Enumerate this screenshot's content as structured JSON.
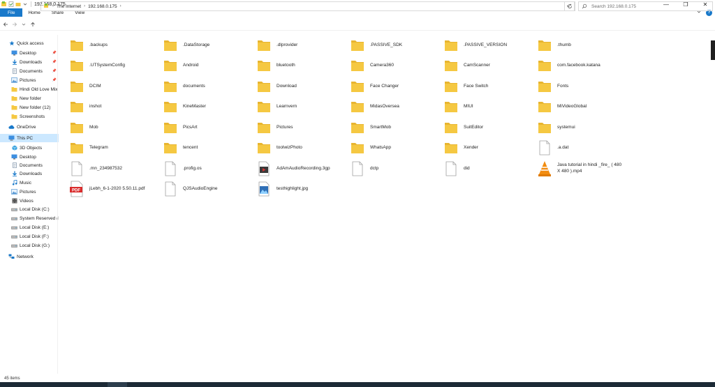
{
  "window": {
    "title": "192.168.0.175",
    "controls": {
      "minimize": "—",
      "maximize": "❐",
      "close": "✕"
    }
  },
  "ribbon": {
    "tabs": [
      "File",
      "Home",
      "Share",
      "View"
    ],
    "help": "?"
  },
  "address": {
    "crumbs": [
      "The Internet",
      "192.168.0.175"
    ],
    "search_placeholder": "Search 192.168.0.175"
  },
  "nav": {
    "items": [
      {
        "label": "Quick access",
        "icon": "star-icon",
        "level": 0,
        "pinned": false,
        "color": "#1979ca"
      },
      {
        "label": "Desktop",
        "icon": "desktop-icon",
        "level": 1,
        "pinned": true,
        "color": "#3d8fe0"
      },
      {
        "label": "Downloads",
        "icon": "download-icon",
        "level": 1,
        "pinned": true,
        "color": "#1979ca"
      },
      {
        "label": "Documents",
        "icon": "documents-icon",
        "level": 1,
        "pinned": true,
        "color": "#7a8fa6"
      },
      {
        "label": "Pictures",
        "icon": "pictures-icon",
        "level": 1,
        "pinned": true,
        "color": "#5b9bd5"
      },
      {
        "label": "Hindi Old Love Mix",
        "icon": "folder-icon",
        "level": 1,
        "pinned": false,
        "color": "#f5c842"
      },
      {
        "label": "New folder",
        "icon": "folder-icon",
        "level": 1,
        "pinned": false,
        "color": "#f5c842"
      },
      {
        "label": "New folder (12)",
        "icon": "folder-icon",
        "level": 1,
        "pinned": false,
        "color": "#f5c842"
      },
      {
        "label": "Screenshots",
        "icon": "folder-icon",
        "level": 1,
        "pinned": false,
        "color": "#f5c842"
      },
      {
        "label": "OneDrive",
        "icon": "cloud-icon",
        "level": 0,
        "pinned": false,
        "color": "#1979ca"
      },
      {
        "label": "This PC",
        "icon": "pc-icon",
        "level": 0,
        "pinned": false,
        "color": "#3d8fe0",
        "selected": true
      },
      {
        "label": "3D Objects",
        "icon": "cube-icon",
        "level": 1,
        "pinned": false,
        "color": "#3da5e0"
      },
      {
        "label": "Desktop",
        "icon": "desktop-icon",
        "level": 1,
        "pinned": false,
        "color": "#3d8fe0"
      },
      {
        "label": "Documents",
        "icon": "documents-icon",
        "level": 1,
        "pinned": false,
        "color": "#7a8fa6"
      },
      {
        "label": "Downloads",
        "icon": "download-icon",
        "level": 1,
        "pinned": false,
        "color": "#1979ca"
      },
      {
        "label": "Music",
        "icon": "music-icon",
        "level": 1,
        "pinned": false,
        "color": "#1979ca"
      },
      {
        "label": "Pictures",
        "icon": "pictures-icon",
        "level": 1,
        "pinned": false,
        "color": "#5b9bd5"
      },
      {
        "label": "Videos",
        "icon": "video-icon",
        "level": 1,
        "pinned": false,
        "color": "#555555"
      },
      {
        "label": "Local Disk (C:)",
        "icon": "drive-icon",
        "level": 1,
        "pinned": false,
        "color": "#666666"
      },
      {
        "label": "System Reserved (D",
        "icon": "drive-icon",
        "level": 1,
        "pinned": false,
        "color": "#666666"
      },
      {
        "label": "Local Disk (E:)",
        "icon": "drive-icon",
        "level": 1,
        "pinned": false,
        "color": "#666666"
      },
      {
        "label": "Local Disk (F:)",
        "icon": "drive-icon",
        "level": 1,
        "pinned": false,
        "color": "#666666"
      },
      {
        "label": "Local Disk (G:)",
        "icon": "drive-icon",
        "level": 1,
        "pinned": false,
        "color": "#666666"
      },
      {
        "label": "Network",
        "icon": "network-icon",
        "level": 0,
        "pinned": false,
        "color": "#1979ca"
      }
    ]
  },
  "files": [
    {
      "name": ".backups",
      "type": "folder"
    },
    {
      "name": ".DataStorage",
      "type": "folder"
    },
    {
      "name": ".dlprovider",
      "type": "folder"
    },
    {
      "name": ".PASSIVE_SDK",
      "type": "folder"
    },
    {
      "name": ".PASSIVE_VERSION",
      "type": "folder"
    },
    {
      "name": ".thumb",
      "type": "folder"
    },
    {
      "name": ".UTSystemConfig",
      "type": "folder"
    },
    {
      "name": "Android",
      "type": "folder"
    },
    {
      "name": "bluetooth",
      "type": "folder"
    },
    {
      "name": "Camera360",
      "type": "folder"
    },
    {
      "name": "CamScanner",
      "type": "folder"
    },
    {
      "name": "com.facebook.katana",
      "type": "folder"
    },
    {
      "name": "DCIM",
      "type": "folder"
    },
    {
      "name": "documents",
      "type": "folder"
    },
    {
      "name": "Download",
      "type": "folder"
    },
    {
      "name": "Face Changer",
      "type": "folder"
    },
    {
      "name": "Face Switch",
      "type": "folder"
    },
    {
      "name": "Fonts",
      "type": "folder"
    },
    {
      "name": "inshot",
      "type": "folder"
    },
    {
      "name": "KineMaster",
      "type": "folder"
    },
    {
      "name": "Learnvern",
      "type": "folder"
    },
    {
      "name": "MidasOversea",
      "type": "folder"
    },
    {
      "name": "MIUI",
      "type": "folder"
    },
    {
      "name": "MiVideoGlobal",
      "type": "folder"
    },
    {
      "name": "Mob",
      "type": "folder"
    },
    {
      "name": "PicsArt",
      "type": "folder"
    },
    {
      "name": "Pictures",
      "type": "folder"
    },
    {
      "name": "SmartMob",
      "type": "folder"
    },
    {
      "name": "SuitEditor",
      "type": "folder"
    },
    {
      "name": "systemui",
      "type": "folder"
    },
    {
      "name": "Telegram",
      "type": "folder"
    },
    {
      "name": "tencent",
      "type": "folder"
    },
    {
      "name": "toolwizPhoto",
      "type": "folder"
    },
    {
      "name": "WhatsApp",
      "type": "folder"
    },
    {
      "name": "Xender",
      "type": "folder"
    },
    {
      "name": ".a.dat",
      "type": "file"
    },
    {
      "name": ".mn_234987532",
      "type": "file"
    },
    {
      "name": ".profig.os",
      "type": "file"
    },
    {
      "name": "AdAmAudioRecording.3gp",
      "type": "media"
    },
    {
      "name": "dctp",
      "type": "file"
    },
    {
      "name": "did",
      "type": "file"
    },
    {
      "name": "Java tutorial in hindi _fire_ ( 480 X 480 ).mp4",
      "type": "vlc"
    },
    {
      "name": "jLebh_6-1-2020 5.50.11.pdf",
      "type": "pdf"
    },
    {
      "name": "QJSAudioEngine",
      "type": "file"
    },
    {
      "name": "testhighlight.jpg",
      "type": "image"
    }
  ],
  "status": {
    "count": "45 items"
  },
  "colors": {
    "accent": "#1979ca",
    "folder": "#f5c842",
    "folder_dark": "#e8b530",
    "selected": "#cce8ff"
  }
}
